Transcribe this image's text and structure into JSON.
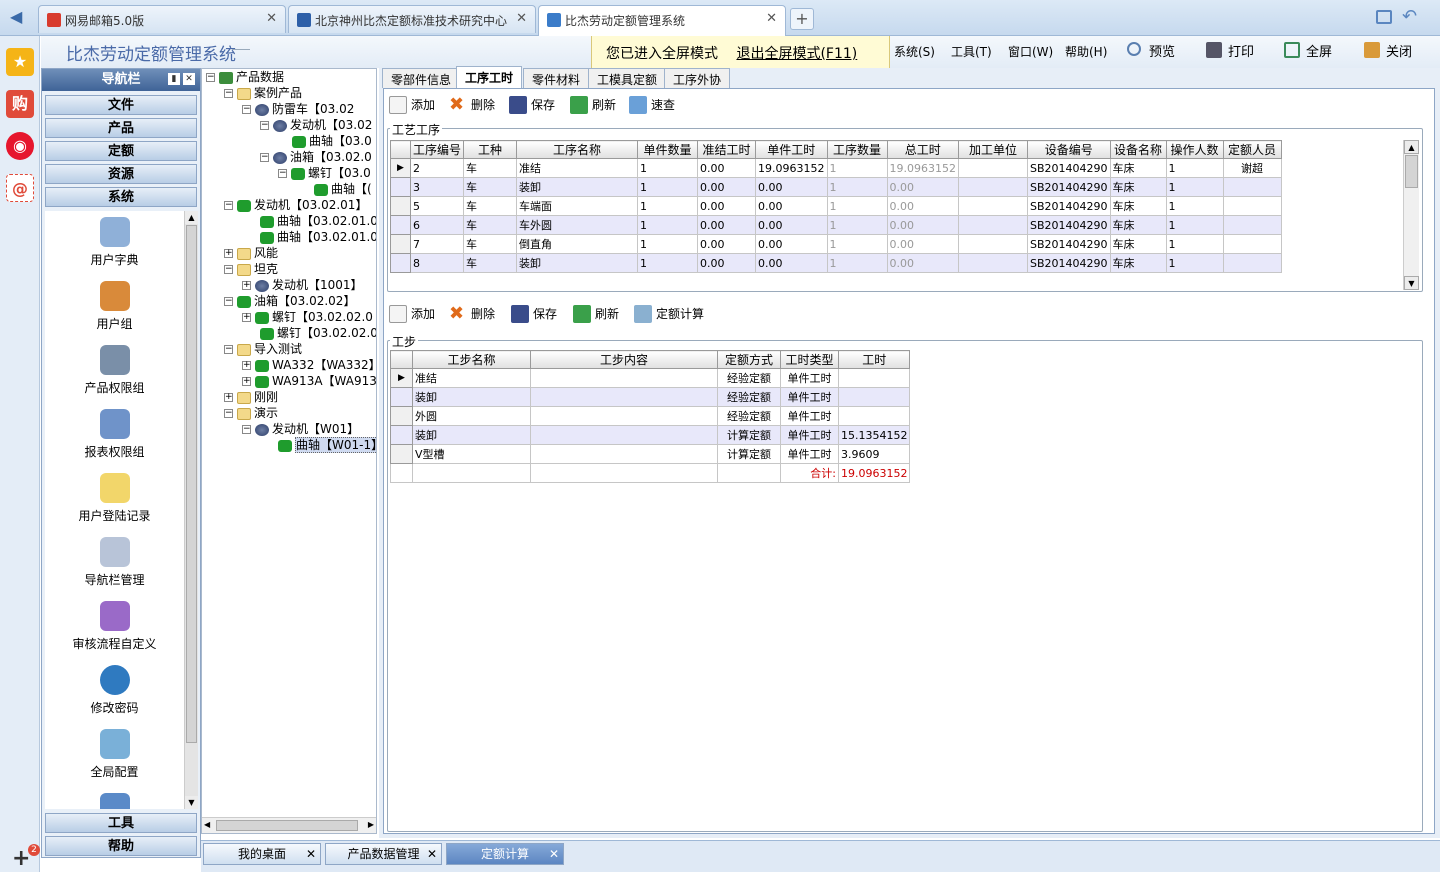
{
  "browser": {
    "tabs": [
      {
        "label": "网易邮箱5.0版"
      },
      {
        "label": "北京神州比杰定额标准技术研究中心"
      },
      {
        "label": "比杰劳动定额管理系统"
      }
    ],
    "new_tab": "+"
  },
  "sidebar": {
    "badge": "2",
    "add": "+"
  },
  "app": {
    "title": "比杰劳动定额管理系统",
    "fullscreen_notice": "您已进入全屏模式",
    "exit_fullscreen": "退出全屏模式(F11)",
    "menus": [
      "系统(S)",
      "工具(T)",
      "窗口(W)",
      "帮助(H)"
    ],
    "toolbar": {
      "preview": "预览",
      "print": "打印",
      "fullscreen": "全屏",
      "close": "关闭"
    }
  },
  "nav": {
    "title": "导航栏",
    "sections_top": [
      "文件",
      "产品",
      "定额",
      "资源",
      "系统"
    ],
    "items": [
      "用户字典",
      "用户组",
      "产品权限组",
      "报表权限组",
      "用户登陆记录",
      "导航栏管理",
      "审核流程自定义",
      "修改密码",
      "全局配置"
    ],
    "sections_bottom": [
      "工具",
      "帮助"
    ]
  },
  "tree": {
    "nodes": [
      {
        "text": "产品数据"
      },
      {
        "text": "案例产品"
      },
      {
        "text": "防雷车【03.02"
      },
      {
        "text": "发动机【03.02"
      },
      {
        "text": "曲轴【03.0"
      },
      {
        "text": "油箱【03.02.0"
      },
      {
        "text": "螺钉【03.0"
      },
      {
        "text": "曲轴【("
      },
      {
        "text": "发动机【03.02.01】"
      },
      {
        "text": "曲轴【03.02.01.0"
      },
      {
        "text": "曲轴【03.02.01.0"
      },
      {
        "text": "风能"
      },
      {
        "text": "坦克"
      },
      {
        "text": "发动机【1001】"
      },
      {
        "text": "油箱【03.02.02】"
      },
      {
        "text": "螺钉【03.02.02.0"
      },
      {
        "text": "螺钉【03.02.02.0"
      },
      {
        "text": "导入测试"
      },
      {
        "text": "WA332【WA332】"
      },
      {
        "text": "WA913A【WA913A】"
      },
      {
        "text": "刚刚"
      },
      {
        "text": "演示"
      },
      {
        "text": "发动机【W01】"
      },
      {
        "text": "曲轴【W01-1】"
      }
    ]
  },
  "page_tabs": [
    "零部件信息",
    "工序工时",
    "零件材料",
    "工模具定额",
    "工序外协"
  ],
  "toolbar1": {
    "add": "添加",
    "delete": "删除",
    "save": "保存",
    "refresh": "刷新",
    "quick": "速查"
  },
  "process_group": {
    "title": "工艺工序",
    "columns": [
      "工序编号",
      "工种",
      "工序名称",
      "单件数量",
      "准结工时",
      "单件工时",
      "工序数量",
      "总工时",
      "加工单位",
      "设备编号",
      "设备名称",
      "操作人数",
      "定额人员"
    ],
    "rows": [
      [
        "2",
        "车",
        "准结",
        "1",
        "0.00",
        "19.0963152",
        "1",
        "19.0963152",
        "",
        "SB201404290",
        "车床",
        "1",
        "谢超"
      ],
      [
        "3",
        "车",
        "装卸",
        "1",
        "0.00",
        "0.00",
        "1",
        "0.00",
        "",
        "SB201404290",
        "车床",
        "1",
        ""
      ],
      [
        "5",
        "车",
        "车端面",
        "1",
        "0.00",
        "0.00",
        "1",
        "0.00",
        "",
        "SB201404290",
        "车床",
        "1",
        ""
      ],
      [
        "6",
        "车",
        "车外圆",
        "1",
        "0.00",
        "0.00",
        "1",
        "0.00",
        "",
        "SB201404290",
        "车床",
        "1",
        ""
      ],
      [
        "7",
        "车",
        "倒直角",
        "1",
        "0.00",
        "0.00",
        "1",
        "0.00",
        "",
        "SB201404290",
        "车床",
        "1",
        ""
      ],
      [
        "8",
        "车",
        "装卸",
        "1",
        "0.00",
        "0.00",
        "1",
        "0.00",
        "",
        "SB201404290",
        "车床",
        "1",
        ""
      ]
    ]
  },
  "toolbar2": {
    "add": "添加",
    "delete": "删除",
    "save": "保存",
    "refresh": "刷新",
    "calc": "定额计算"
  },
  "step_group": {
    "title": "工步",
    "columns": [
      "工步名称",
      "工步内容",
      "定额方式",
      "工时类型",
      "工时"
    ],
    "rows": [
      [
        "准结",
        "",
        "经验定额",
        "单件工时",
        ""
      ],
      [
        "装卸",
        "",
        "经验定额",
        "单件工时",
        ""
      ],
      [
        "外圆",
        "",
        "经验定额",
        "单件工时",
        ""
      ],
      [
        "装卸",
        "",
        "计算定额",
        "单件工时",
        "15.1354152"
      ],
      [
        "V型槽",
        "",
        "计算定额",
        "单件工时",
        "3.9609"
      ]
    ],
    "total_label": "合计:",
    "total_value": "19.0963152"
  },
  "bottom_tabs": [
    "我的桌面",
    "产品数据管理",
    "定额计算"
  ]
}
